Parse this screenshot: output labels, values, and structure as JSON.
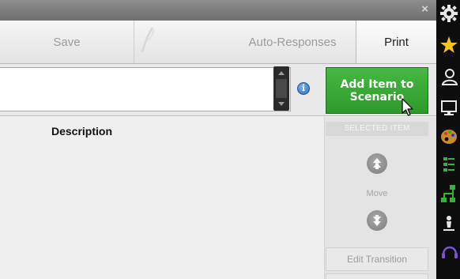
{
  "titlebar": {
    "close_glyph": "×"
  },
  "toolbar": {
    "save_label": "Save",
    "auto_responses_label": "Auto-Responses",
    "print_label": "Print"
  },
  "input": {
    "value": ""
  },
  "add_item_button": {
    "line1": "Add Item to",
    "line2": "Scenario"
  },
  "content": {
    "description_header": "Description"
  },
  "side_panel": {
    "header": "SELECTED ITEM",
    "move_label": "Move",
    "edit_transition_label": "Edit Transition"
  },
  "icon_strip": [
    "gear-icon",
    "star-icon",
    "user-icon",
    "monitor-icon",
    "palette-icon",
    "list-icon",
    "network-icon",
    "person-icon",
    "headset-icon"
  ],
  "colors": {
    "accent_green": "#3aa837",
    "info_blue": "#2c6cc8",
    "strip_bg": "#0d0d0d"
  }
}
